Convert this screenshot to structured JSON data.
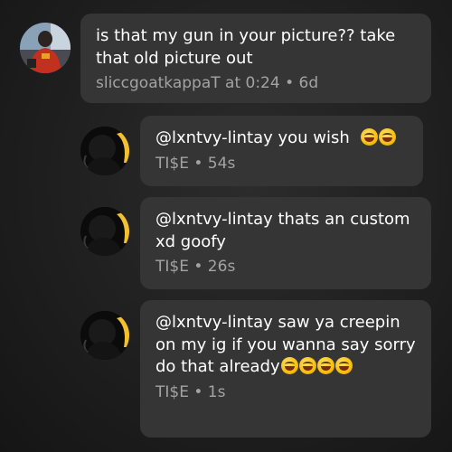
{
  "comments": [
    {
      "text": "is that my gun in your picture?? take that old picture out",
      "author": "sliccgoatkappaT",
      "meta_suffix": "at 0:24 • 6d",
      "avatar": "user-avatar-red-jacket",
      "emoji_count": 0
    },
    {
      "text": "@lxntvy-lintay you wish ",
      "author": "TI$E",
      "meta_suffix": "• 54s",
      "avatar": "user-avatar-dark",
      "emoji_count": 2,
      "emoji": "rolling-on-floor-laughing"
    },
    {
      "text": "@lxntvy-lintay thats an custom xd goofy",
      "author": "TI$E",
      "meta_suffix": "• 26s",
      "avatar": "user-avatar-dark",
      "emoji_count": 0
    },
    {
      "text": "@lxntvy-lintay saw ya creepin on my ig if you wanna say sorry do that already",
      "author": "TI$E",
      "meta_suffix": "• 1s",
      "avatar": "user-avatar-dark",
      "emoji_count": 4,
      "emoji": "rolling-on-floor-laughing"
    }
  ],
  "colors": {
    "bubble": "#353535",
    "text": "#ffffff",
    "meta": "#a3a3a3",
    "background": "#232323"
  }
}
